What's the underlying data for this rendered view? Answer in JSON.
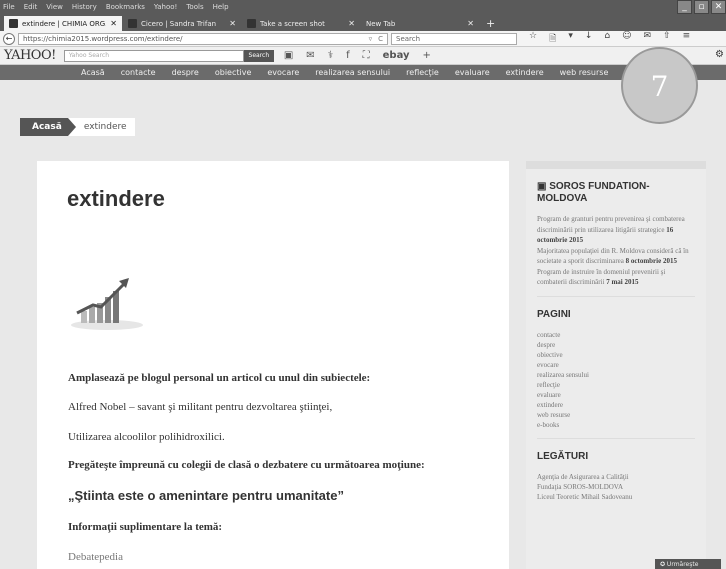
{
  "menubar": [
    "File",
    "Edit",
    "View",
    "History",
    "Bookmarks",
    "Yahoo!",
    "Tools",
    "Help"
  ],
  "window_controls": [
    "_",
    "▫",
    "✕"
  ],
  "tabs": [
    {
      "title": "extindere | CHIMIA ORG...",
      "close": "✕"
    },
    {
      "title": "Cicero | Sandra Trifan",
      "close": "✕"
    },
    {
      "title": "Take a screen shot",
      "close": "✕"
    },
    {
      "title": "New Tab",
      "close": "✕"
    }
  ],
  "new_tab": "+",
  "navbar": {
    "back": "←",
    "url": "https://chimia2015.wordpress.com/extindere/",
    "dropdown": "▿",
    "reload": "C",
    "search_placeholder": "Search",
    "icons": [
      "☆",
      "🗎",
      "▾",
      "↓",
      "⌂",
      "☺",
      "✉",
      "⇧",
      "≡"
    ]
  },
  "yahoobar": {
    "logo": "YAHOO!",
    "search_placeholder": "Yahoo Search",
    "search_button": "Search",
    "tools": [
      "▣",
      "✉",
      "⚕",
      "f",
      "⛶",
      "ebay",
      "+"
    ],
    "gear": "⚙"
  },
  "sitenav": [
    "Acasă",
    "contacte",
    "despre",
    "obiective",
    "evocare",
    "realizarea sensului",
    "reflecţie",
    "evaluare",
    "extindere",
    "web resurse",
    "e-books"
  ],
  "badge": "7",
  "breadcrumb": {
    "home": "Acasă",
    "current": "extindere"
  },
  "content": {
    "title": "extindere",
    "lines": [
      "Amplasează pe blogul personal  un articol cu unul din subiectele:",
      "Alfred Nobel – savant şi militant pentru dezvoltarea ştiinţei,",
      "Utilizarea alcoolilor polihidroxilici.",
      "Pregăteşte împreună cu colegii de clasă o dezbatere cu următoarea moţiune:"
    ],
    "quote": "„Ştiinta este o amenintare pentru umanitate”",
    "info": "Informaţii suplimentare la temă:",
    "link": "Debatepedia"
  },
  "sidebar": {
    "soros": {
      "title": "SOROS FUNDATION-MOLDOVA",
      "posts": [
        {
          "text": "Program de granturi pentru prevenirea şi combaterea discriminării prin utilizarea litigării strategice",
          "date": "16 octombrie 2015"
        },
        {
          "text": "Majoritatea populaţiei din R. Moldova consideră că în societate a sporit discriminarea",
          "date": "8 octombrie 2015"
        },
        {
          "text": "Program de instruire în domeniul prevenirii şi combaterii discriminării",
          "date": "7 mai 2015"
        }
      ]
    },
    "pagini": {
      "title": "PAGINI",
      "items": [
        "contacte",
        "despre",
        "obiective",
        "evocare",
        "realizarea sensului",
        "reflecţie",
        "evaluare",
        "extindere",
        "web resurse",
        "e-books"
      ]
    },
    "legaturi": {
      "title": "LEGĂTURI",
      "items": [
        "Agenţia de Asigurarea a Calităţii",
        "Fundaţia SOROS-MOLDOVA",
        "Liceul Teoretic Mihail Sadoveanu"
      ]
    }
  },
  "follow_button": "✪ Urmăreşte"
}
